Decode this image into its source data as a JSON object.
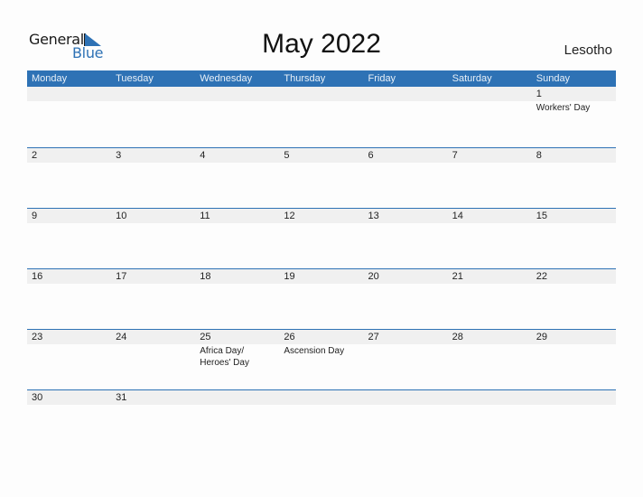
{
  "logo": {
    "word1": "General",
    "word2": "Blue",
    "accent": "#2e72b5"
  },
  "title": "May 2022",
  "country": "Lesotho",
  "header": {
    "days": [
      "Monday",
      "Tuesday",
      "Wednesday",
      "Thursday",
      "Friday",
      "Saturday",
      "Sunday"
    ],
    "color": "#2e72b5"
  },
  "weeks": [
    [
      {
        "d": ""
      },
      {
        "d": ""
      },
      {
        "d": ""
      },
      {
        "d": ""
      },
      {
        "d": ""
      },
      {
        "d": ""
      },
      {
        "d": "1",
        "e": "Workers' Day"
      }
    ],
    [
      {
        "d": "2"
      },
      {
        "d": "3"
      },
      {
        "d": "4"
      },
      {
        "d": "5"
      },
      {
        "d": "6"
      },
      {
        "d": "7"
      },
      {
        "d": "8"
      }
    ],
    [
      {
        "d": "9"
      },
      {
        "d": "10"
      },
      {
        "d": "11"
      },
      {
        "d": "12"
      },
      {
        "d": "13"
      },
      {
        "d": "14"
      },
      {
        "d": "15"
      }
    ],
    [
      {
        "d": "16"
      },
      {
        "d": "17"
      },
      {
        "d": "18"
      },
      {
        "d": "19"
      },
      {
        "d": "20"
      },
      {
        "d": "21"
      },
      {
        "d": "22"
      }
    ],
    [
      {
        "d": "23"
      },
      {
        "d": "24"
      },
      {
        "d": "25",
        "e": "Africa Day/ Heroes' Day"
      },
      {
        "d": "26",
        "e": "Ascension Day"
      },
      {
        "d": "27"
      },
      {
        "d": "28"
      },
      {
        "d": "29"
      }
    ],
    [
      {
        "d": "30"
      },
      {
        "d": "31"
      },
      {
        "d": ""
      },
      {
        "d": ""
      },
      {
        "d": ""
      },
      {
        "d": ""
      },
      {
        "d": ""
      }
    ]
  ]
}
